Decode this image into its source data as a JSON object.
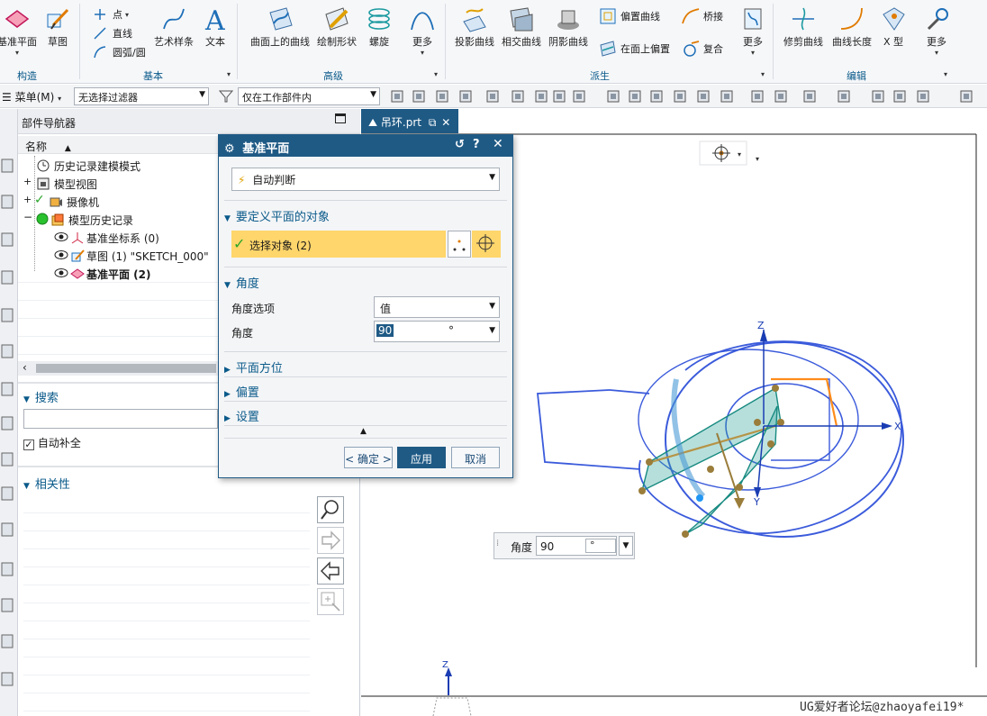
{
  "ribbon": {
    "buttons": {
      "datum_plane": "基准平面",
      "sketch": "草图",
      "point": "点",
      "line": "直线",
      "arc_circle": "圆弧/圆",
      "art_spline": "艺术样条",
      "text": "文本",
      "curve_on_surface": "曲面上的曲线",
      "draw_shape": "绘制形状",
      "helix": "螺旋",
      "more_advanced": "更多",
      "project_curve": "投影曲线",
      "intersect_curve": "相交曲线",
      "shadow_curve": "阴影曲线",
      "offset_curve": "偏置曲线",
      "offset_on_face": "在面上偏置",
      "bridge": "桥接",
      "composite": "复合",
      "more_derived": "更多",
      "trim_curve": "修剪曲线",
      "curve_length": "曲线长度",
      "x_type": "X 型",
      "more_edit": "更多"
    },
    "groups": {
      "construct": "构造",
      "basic": "基本",
      "advanced": "高级",
      "derived": "派生",
      "edit": "编辑"
    }
  },
  "toolbar2": {
    "menu": "菜单(M)",
    "filter": "无选择过滤器",
    "scope": "仅在工作部件内"
  },
  "navigator": {
    "title": "部件导航器",
    "column_name": "名称",
    "tree": [
      {
        "label": "历史记录建模模式",
        "bold": false
      },
      {
        "label": "模型视图",
        "bold": false
      },
      {
        "label": "摄像机",
        "bold": false
      },
      {
        "label": "模型历史记录",
        "bold": false
      },
      {
        "label": "基准坐标系 (0)",
        "bold": false
      },
      {
        "label": "草图 (1) \"SKETCH_000\"",
        "bold": false
      },
      {
        "label": "基准平面 (2)",
        "bold": true
      }
    ],
    "search_title": "搜索",
    "autocomplete_label": "自动补全",
    "autocomplete_checked": true,
    "relevance_title": "相关性"
  },
  "document_tab": {
    "label": "吊环.prt"
  },
  "dialog": {
    "title": "基准平面",
    "type_value": "自动判断",
    "objects_section": "要定义平面的对象",
    "select_objects": "选择对象 (2)",
    "angle_section": "角度",
    "angle_option_label": "角度选项",
    "angle_option_value": "值",
    "angle_label": "角度",
    "angle_value": "90",
    "angle_unit": "°",
    "plane_orientation": "平面方位",
    "offset": "偏置",
    "settings": "设置",
    "ok": "< 确定 >",
    "apply": "应用",
    "cancel": "取消"
  },
  "graphics": {
    "angle_popup_label": "角度",
    "angle_popup_value": "90",
    "angle_popup_unit": "°",
    "axis_x": "X",
    "axis_y": "Y",
    "axis_z": "Z",
    "axis_z2": "Z",
    "watermark": "UG爱好者论坛@zhaoyafei19*"
  },
  "colors": {
    "accent": "#1f5a85",
    "section_text": "#0a5a8a",
    "highlight": "#ffd66b",
    "model_blue": "#3b5bdb",
    "plane_teal": "#2fa39a",
    "orange": "#ff8c1a"
  }
}
